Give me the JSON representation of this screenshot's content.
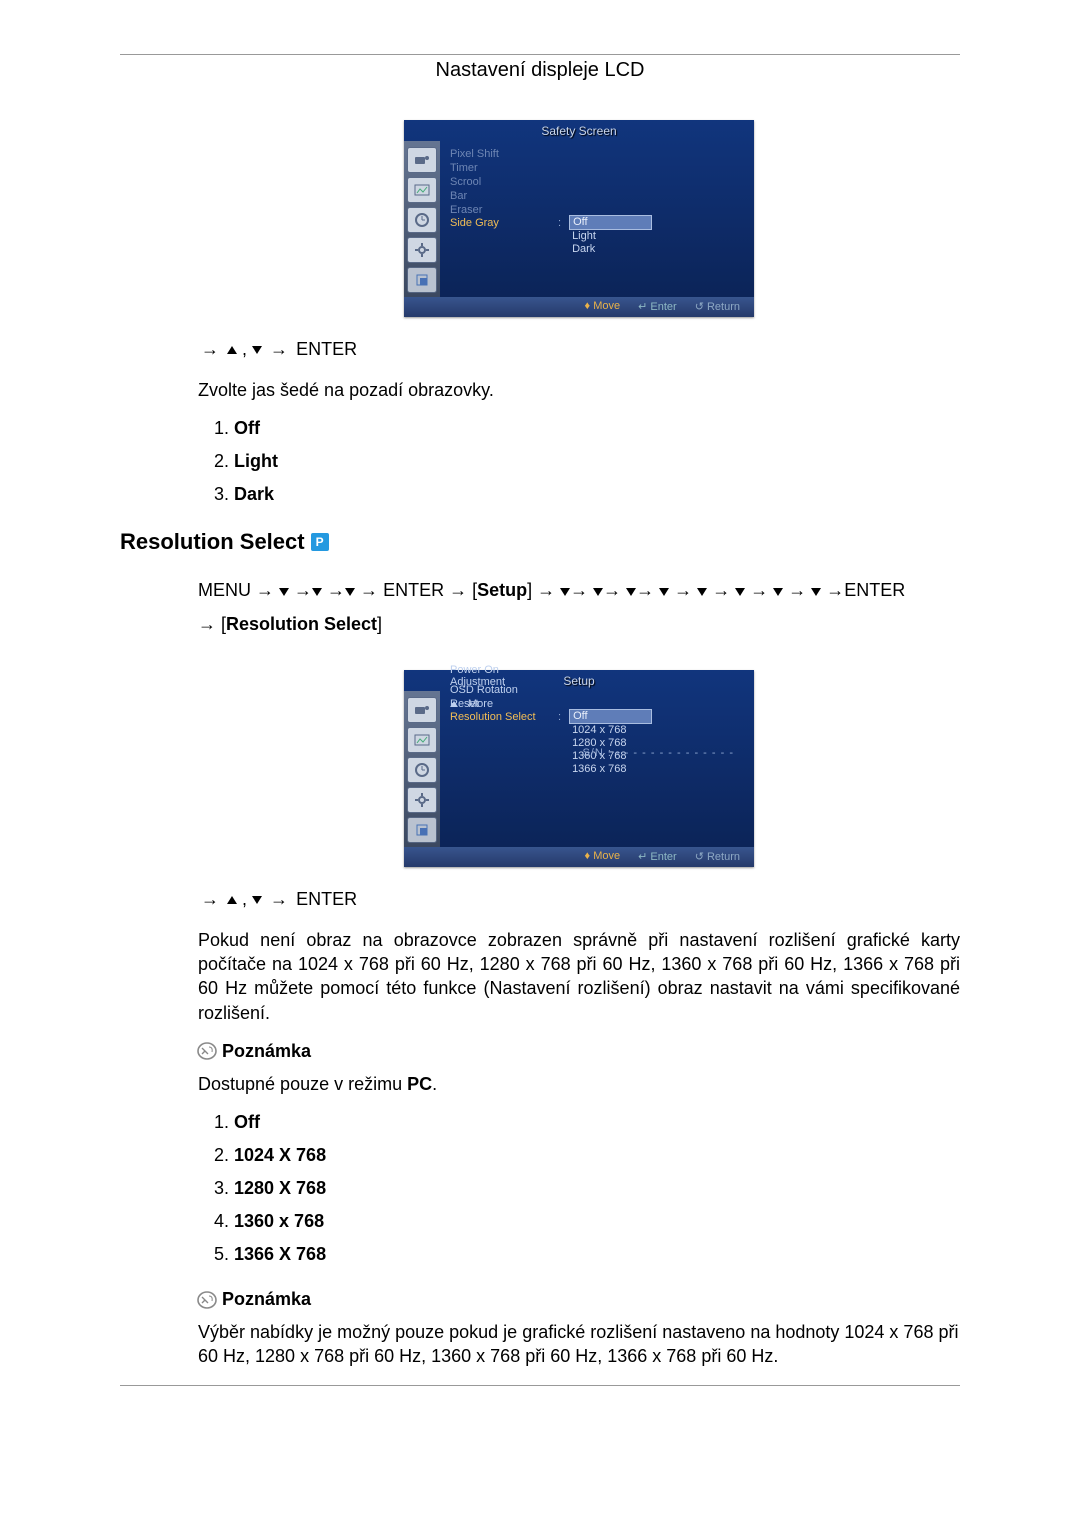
{
  "header": {
    "title": "Nastavení displeje LCD"
  },
  "osd1": {
    "title": "Safety Screen",
    "items": [
      {
        "label": "Pixel Shift",
        "class": "dim"
      },
      {
        "label": "Timer",
        "class": "dim"
      },
      {
        "label": "Scrool",
        "class": "dim"
      },
      {
        "label": "Bar",
        "class": "dim"
      },
      {
        "label": "Eraser",
        "class": "dim"
      },
      {
        "label": "Side Gray",
        "class": "hl"
      }
    ],
    "options": [
      "Off",
      "Light",
      "Dark"
    ],
    "foot_move": "Move",
    "foot_enter": "Enter",
    "foot_return": "Return"
  },
  "nav1": {
    "enter": "ENTER"
  },
  "sidegray": {
    "desc": "Zvolte jas šedé na pozadí obrazovky.",
    "options": [
      "Off",
      "Light",
      "Dark"
    ]
  },
  "section2": {
    "heading": "Resolution Select",
    "badge": "P"
  },
  "menupath": {
    "menu": "MENU",
    "enter": "ENTER",
    "setup": "Setup",
    "resolution_select": "Resolution Select"
  },
  "osd2": {
    "title": "Setup",
    "more": "More",
    "items": [
      {
        "label": "Resolution Select",
        "class": "hl"
      },
      {
        "label": "Power On Adjustment",
        "class": ""
      },
      {
        "label": "OSD Rotation",
        "class": ""
      },
      {
        "label": "Reset",
        "class": ""
      }
    ],
    "options": [
      "Off",
      "1024 x 768",
      "1280 x 768",
      "1360 x 768",
      "1366 x 768"
    ],
    "sn_label": "S/N",
    "sn_value": "- - - - - - - - - - - - - -",
    "foot_move": "Move",
    "foot_enter": "Enter",
    "foot_return": "Return"
  },
  "nav2": {
    "enter": "ENTER"
  },
  "resolution": {
    "desc": "Pokud není obraz na obrazovce zobrazen správně při nastavení rozlišení grafické karty počítače na 1024 x 768 při 60 Hz, 1280 x 768 při 60 Hz, 1360 x 768 při 60 Hz, 1366 x 768 při 60 Hz můžete pomocí této funkce (Nastavení rozlišení) obraz nastavit na vámi specifikované rozlišení.",
    "note_label": "Poznámka",
    "note1_pre": "Dostupné pouze v režimu ",
    "note1_pc": "PC",
    "note1_post": ".",
    "options": [
      "Off",
      "1024 X 768",
      "1280 X 768",
      "1360 x 768",
      "1366 X 768"
    ],
    "note2": "Výběr nabídky je možný pouze pokud je grafické rozlišení nastaveno na hodnoty 1024 x 768 při 60 Hz, 1280 x 768 při 60 Hz, 1360 x 768 při 60 Hz, 1366 x 768 při 60 Hz."
  }
}
